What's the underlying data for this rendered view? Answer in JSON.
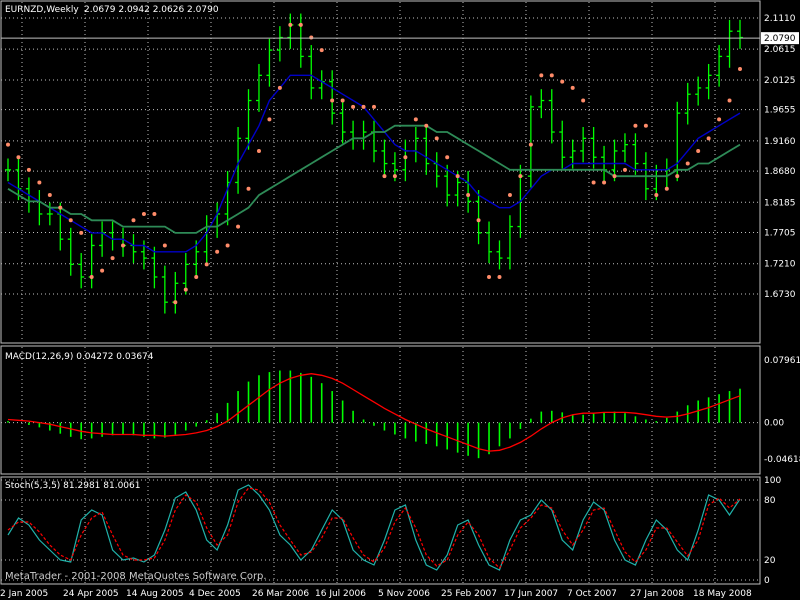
{
  "window": {
    "symbol_header": "EURNZD,Weekly",
    "ohlc_header": "2.0679 2.0942 2.0626 2.0790",
    "last_price_tag": "2.0790",
    "watermark": "MetaTrader - 2001-2008 MetaQuotes Software Corp.",
    "colors": {
      "bull": "#00ff00",
      "sar": "#ff8c6a",
      "ma_fast": "#0000c8",
      "ma_slow": "#2e8b57",
      "hist": "#00ff00",
      "signal": "#ff0000",
      "stoch_main": "#20b2aa",
      "stoch_signal": "#ff0000",
      "grid": "#c0c0c0",
      "text": "#ffffff"
    }
  },
  "chart_data": [
    {
      "type": "line",
      "title": "EURNZD,Weekly",
      "ylim": [
        1.6,
        2.13
      ],
      "y_ticks": [
        "2.1110",
        "2.0615",
        "2.0125",
        "1.9655",
        "1.9160",
        "1.8680",
        "1.8185",
        "1.7705",
        "1.7210",
        "1.6730"
      ],
      "x_ticks": [
        "2 Jan 2005",
        "24 Apr 2005",
        "14 Aug 2005",
        "4 Dec 2005",
        "26 Mar 2006",
        "16 Jul 2006",
        "5 Nov 2006",
        "25 Feb 2007",
        "17 Jun 2007",
        "7 Oct 2007",
        "27 Jan 2008",
        "18 May 2008"
      ],
      "series": [
        {
          "name": "price",
          "values": [
            1.87,
            1.84,
            1.82,
            1.8,
            1.8,
            1.76,
            1.72,
            1.7,
            1.75,
            1.77,
            1.76,
            1.75,
            1.74,
            1.73,
            1.7,
            1.66,
            1.69,
            1.72,
            1.74,
            1.78,
            1.8,
            1.85,
            1.92,
            1.98,
            2.02,
            2.06,
            2.08,
            2.1,
            2.05,
            2.0,
            2.01,
            1.96,
            1.93,
            1.92,
            1.93,
            1.9,
            1.88,
            1.87,
            1.9,
            1.92,
            1.88,
            1.86,
            1.83,
            1.85,
            1.82,
            1.77,
            1.74,
            1.73,
            1.78,
            1.86,
            1.97,
            1.98,
            1.93,
            1.89,
            1.9,
            1.92,
            1.89,
            1.87,
            1.9,
            1.91,
            1.88,
            1.84,
            1.86,
            1.87,
            1.96,
            1.99,
            2.0,
            2.02,
            2.05,
            2.09,
            2.08
          ]
        },
        {
          "name": "sar",
          "values": [
            1.91,
            1.89,
            1.87,
            1.85,
            1.83,
            1.81,
            1.79,
            1.77,
            1.7,
            1.71,
            1.73,
            1.75,
            1.79,
            1.8,
            1.8,
            1.75,
            1.66,
            1.68,
            1.7,
            1.72,
            1.74,
            1.75,
            1.78,
            1.84,
            1.9,
            1.95,
            2.0,
            2.1,
            2.1,
            2.08,
            2.06,
            1.98,
            1.98,
            1.97,
            1.97,
            1.97,
            1.86,
            1.86,
            1.89,
            1.95,
            1.94,
            1.92,
            1.89,
            1.86,
            1.83,
            1.79,
            1.7,
            1.7,
            1.83,
            1.86,
            1.91,
            2.02,
            2.02,
            2.01,
            2.0,
            1.98,
            1.85,
            1.85,
            1.86,
            1.87,
            1.94,
            1.94,
            1.83,
            1.84,
            1.86,
            1.88,
            1.9,
            1.92,
            1.95,
            1.98,
            2.03
          ]
        },
        {
          "name": "ma_fast",
          "values": [
            1.85,
            1.84,
            1.83,
            1.82,
            1.81,
            1.8,
            1.79,
            1.78,
            1.77,
            1.77,
            1.76,
            1.76,
            1.75,
            1.75,
            1.74,
            1.74,
            1.74,
            1.74,
            1.75,
            1.77,
            1.8,
            1.84,
            1.88,
            1.91,
            1.94,
            1.98,
            2.0,
            2.02,
            2.02,
            2.02,
            2.01,
            2.0,
            1.99,
            1.98,
            1.97,
            1.95,
            1.93,
            1.91,
            1.9,
            1.9,
            1.89,
            1.88,
            1.87,
            1.86,
            1.85,
            1.83,
            1.82,
            1.81,
            1.81,
            1.82,
            1.84,
            1.86,
            1.87,
            1.87,
            1.88,
            1.88,
            1.88,
            1.88,
            1.88,
            1.88,
            1.87,
            1.87,
            1.87,
            1.87,
            1.88,
            1.9,
            1.92,
            1.93,
            1.94,
            1.95,
            1.96
          ]
        },
        {
          "name": "ma_slow",
          "values": [
            1.84,
            1.83,
            1.82,
            1.82,
            1.81,
            1.81,
            1.8,
            1.8,
            1.79,
            1.79,
            1.79,
            1.78,
            1.78,
            1.78,
            1.78,
            1.78,
            1.77,
            1.77,
            1.77,
            1.78,
            1.78,
            1.79,
            1.8,
            1.81,
            1.83,
            1.84,
            1.85,
            1.86,
            1.87,
            1.88,
            1.89,
            1.9,
            1.91,
            1.92,
            1.92,
            1.93,
            1.93,
            1.94,
            1.94,
            1.94,
            1.94,
            1.93,
            1.93,
            1.92,
            1.91,
            1.9,
            1.89,
            1.88,
            1.87,
            1.87,
            1.87,
            1.87,
            1.87,
            1.87,
            1.87,
            1.87,
            1.87,
            1.87,
            1.86,
            1.86,
            1.86,
            1.86,
            1.86,
            1.86,
            1.87,
            1.87,
            1.88,
            1.88,
            1.89,
            1.9,
            1.91
          ]
        }
      ]
    },
    {
      "type": "bar",
      "title": "MACD(12,26,9) 0.04272 0.03674",
      "ylim": [
        -0.06,
        0.092
      ],
      "y_ticks": [
        "0.07961",
        "0.00",
        "-0.04618"
      ],
      "series": [
        {
          "name": "macd",
          "values": [
            0.002,
            0.0,
            -0.003,
            -0.006,
            -0.01,
            -0.014,
            -0.018,
            -0.021,
            -0.02,
            -0.018,
            -0.016,
            -0.015,
            -0.016,
            -0.018,
            -0.02,
            -0.019,
            -0.015,
            -0.01,
            -0.005,
            0.003,
            0.012,
            0.025,
            0.04,
            0.052,
            0.06,
            0.064,
            0.066,
            0.066,
            0.063,
            0.058,
            0.05,
            0.04,
            0.028,
            0.015,
            0.004,
            -0.004,
            -0.01,
            -0.015,
            -0.02,
            -0.024,
            -0.027,
            -0.03,
            -0.034,
            -0.038,
            -0.042,
            -0.045,
            -0.04,
            -0.03,
            -0.02,
            -0.008,
            0.005,
            0.014,
            0.015,
            0.013,
            0.01,
            0.01,
            0.012,
            0.013,
            0.014,
            0.012,
            0.008,
            0.004,
            0.002,
            0.006,
            0.014,
            0.022,
            0.028,
            0.032,
            0.036,
            0.04,
            0.043
          ]
        },
        {
          "name": "signal",
          "values": [
            0.004,
            0.003,
            0.002,
            0.0,
            -0.002,
            -0.005,
            -0.008,
            -0.011,
            -0.013,
            -0.014,
            -0.015,
            -0.015,
            -0.015,
            -0.016,
            -0.016,
            -0.017,
            -0.016,
            -0.015,
            -0.013,
            -0.01,
            -0.005,
            0.002,
            0.012,
            0.022,
            0.032,
            0.042,
            0.05,
            0.056,
            0.06,
            0.062,
            0.06,
            0.056,
            0.05,
            0.042,
            0.034,
            0.026,
            0.018,
            0.011,
            0.004,
            -0.002,
            -0.008,
            -0.013,
            -0.018,
            -0.023,
            -0.028,
            -0.033,
            -0.036,
            -0.035,
            -0.031,
            -0.025,
            -0.017,
            -0.008,
            0.0,
            0.006,
            0.01,
            0.012,
            0.012,
            0.013,
            0.013,
            0.013,
            0.012,
            0.01,
            0.008,
            0.007,
            0.008,
            0.011,
            0.015,
            0.019,
            0.024,
            0.029,
            0.034
          ]
        }
      ]
    },
    {
      "type": "line",
      "title": "Stoch(5,3,5) 81.2981 81.0061",
      "ylim": [
        0,
        100
      ],
      "y_ticks": [
        "100",
        "80",
        "20",
        "0"
      ],
      "series": [
        {
          "name": "main",
          "values": [
            45,
            62,
            55,
            40,
            30,
            20,
            18,
            60,
            70,
            65,
            30,
            20,
            22,
            18,
            25,
            50,
            82,
            88,
            70,
            40,
            30,
            55,
            90,
            95,
            85,
            70,
            45,
            35,
            20,
            30,
            50,
            70,
            60,
            30,
            20,
            15,
            40,
            70,
            75,
            40,
            15,
            10,
            25,
            55,
            60,
            35,
            15,
            10,
            40,
            60,
            65,
            80,
            70,
            40,
            30,
            60,
            78,
            70,
            40,
            20,
            15,
            40,
            60,
            50,
            30,
            20,
            50,
            85,
            80,
            65,
            81
          ]
        },
        {
          "name": "signal",
          "values": [
            50,
            58,
            58,
            48,
            35,
            25,
            20,
            45,
            62,
            68,
            45,
            25,
            20,
            20,
            22,
            40,
            70,
            85,
            78,
            52,
            35,
            45,
            78,
            92,
            90,
            78,
            55,
            40,
            25,
            28,
            42,
            62,
            62,
            42,
            25,
            18,
            32,
            58,
            72,
            52,
            25,
            14,
            20,
            45,
            58,
            45,
            22,
            12,
            30,
            52,
            62,
            75,
            72,
            50,
            35,
            50,
            70,
            72,
            50,
            28,
            18,
            30,
            52,
            52,
            38,
            24,
            40,
            75,
            82,
            72,
            81
          ]
        }
      ]
    }
  ]
}
